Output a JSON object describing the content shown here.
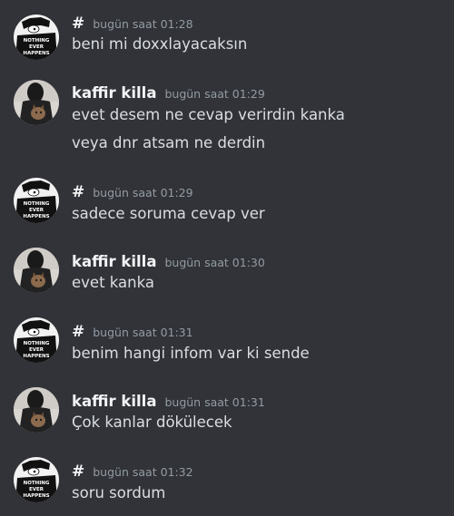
{
  "messages": [
    {
      "author": "#",
      "avatar": "nothing-ever-happens-avatar",
      "time": "bugün saat 01:28",
      "lines": [
        "beni mi doxxlayacaksın"
      ]
    },
    {
      "author": "kaffir killa",
      "avatar": "masked-person-cat-avatar",
      "time": "bugün saat 01:29",
      "lines": [
        "evet desem ne cevap verirdin kanka",
        "veya dnr atsam ne derdin"
      ]
    },
    {
      "author": "#",
      "avatar": "nothing-ever-happens-avatar",
      "time": "bugün saat 01:29",
      "lines": [
        "sadece soruma cevap ver"
      ]
    },
    {
      "author": "kaffir killa",
      "avatar": "masked-person-cat-avatar",
      "time": "bugün saat 01:30",
      "lines": [
        "evet kanka"
      ]
    },
    {
      "author": "#",
      "avatar": "nothing-ever-happens-avatar",
      "time": "bugün saat 01:31",
      "lines": [
        "benim hangi infom var ki sende"
      ]
    },
    {
      "author": "kaffir killa",
      "avatar": "masked-person-cat-avatar",
      "time": "bugün saat 01:31",
      "lines": [
        "Çok kanlar dökülecek"
      ]
    },
    {
      "author": "#",
      "avatar": "nothing-ever-happens-avatar",
      "time": "bugün saat 01:32",
      "lines": [
        "soru sordum"
      ]
    }
  ],
  "avatar_text": {
    "line1": "NOTHING",
    "line2": "EVER",
    "line3": "HAPPENS"
  },
  "colors": {
    "background": "#313338",
    "author": "#f2f3f5",
    "timestamp": "#949ba4",
    "message_text": "#dbdee1"
  }
}
